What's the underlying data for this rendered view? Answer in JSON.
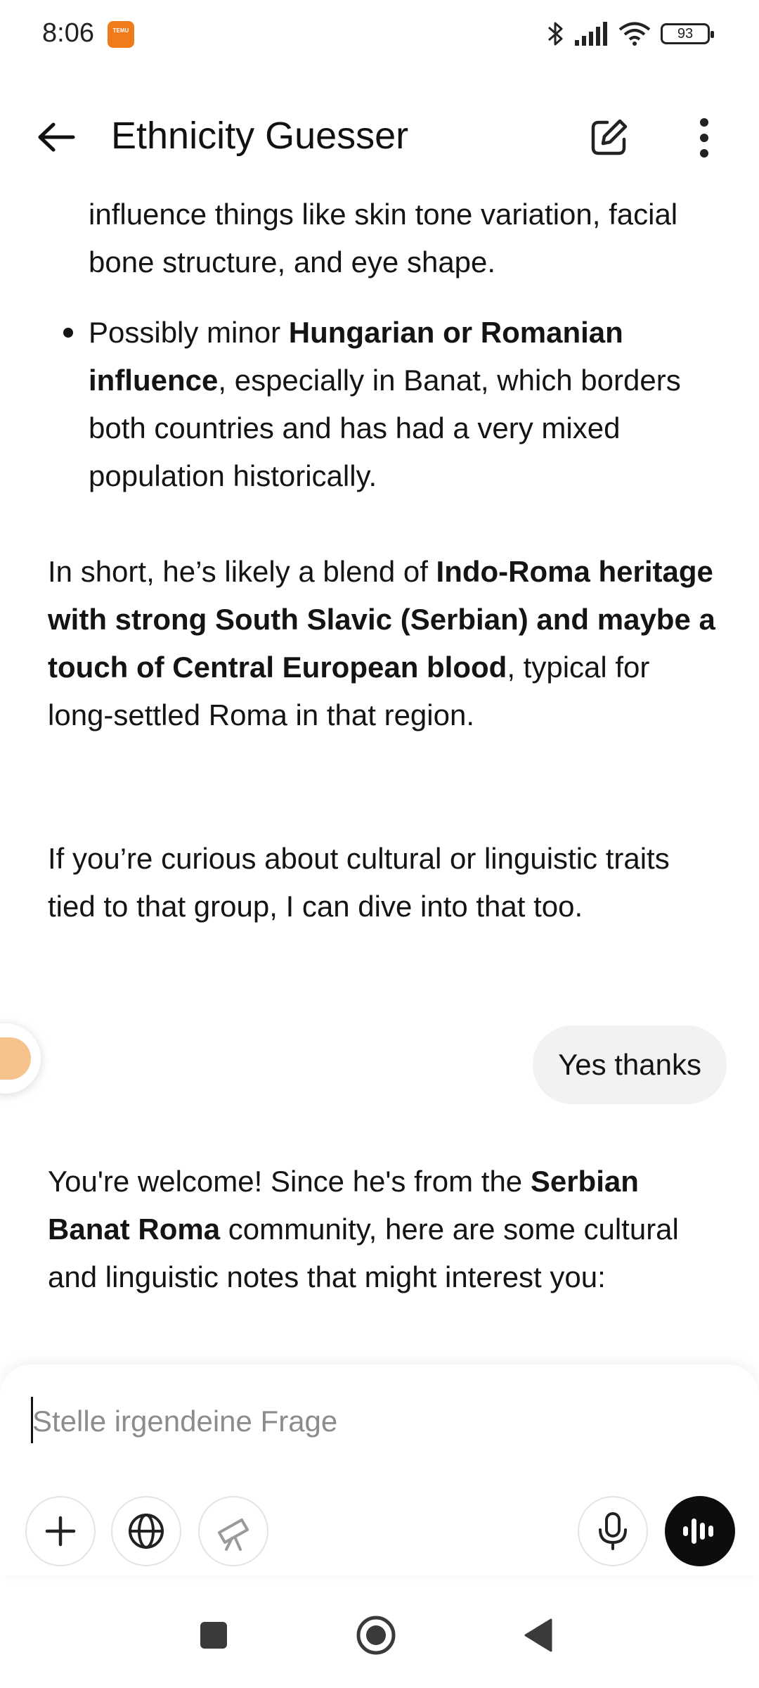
{
  "status_bar": {
    "time": "8:06",
    "notification_badge": "TEMU",
    "battery_level": "93",
    "icons": [
      "bluetooth-icon",
      "signal-icon",
      "wifi-icon",
      "battery-icon"
    ]
  },
  "app_bar": {
    "title": "Ethnicity Guesser",
    "icons": [
      "back-arrow-icon",
      "edit-icon",
      "more-vert-icon"
    ]
  },
  "chat": {
    "assistant_bullet_continuation": "influence things like skin tone variation, facial bone structure, and eye shape.",
    "assistant_bullet": {
      "prefix": "Possibly minor ",
      "bold": "Hungarian or Romanian influence",
      "suffix": ", especially in Banat, which borders both countries and has had a very mixed population historically."
    },
    "assistant_summary": {
      "prefix": "In short, he’s likely a blend of ",
      "bold": "Indo-Roma heritage with strong South Slavic (Serbian) and maybe a touch of Central European blood",
      "suffix": ", typical for long-settled Roma in that region."
    },
    "assistant_offer": "If you’re curious about cultural or linguistic traits tied to that group, I can dive into that too.",
    "user_message": "Yes thanks",
    "assistant_reply": {
      "prefix": "You're welcome! Since he's from the ",
      "bold": "Serbian Banat Roma",
      "suffix": " community, here are some cultural and linguistic notes that might interest you:"
    }
  },
  "composer": {
    "placeholder": "Stelle irgendeine Frage",
    "value": "",
    "buttons": [
      "plus-icon",
      "globe-icon",
      "telescope-icon",
      "microphone-icon",
      "voice-mode-icon"
    ]
  },
  "nav_bar": {
    "buttons": [
      "recents-icon",
      "home-icon",
      "back-icon"
    ]
  },
  "colors": {
    "background": "#ffffff",
    "text": "#141414",
    "user_bubble": "#f2f2f2",
    "voice_button": "#0d0d0d",
    "temu_badge": "#f07b1b",
    "side_fab": "#f6c38c"
  }
}
